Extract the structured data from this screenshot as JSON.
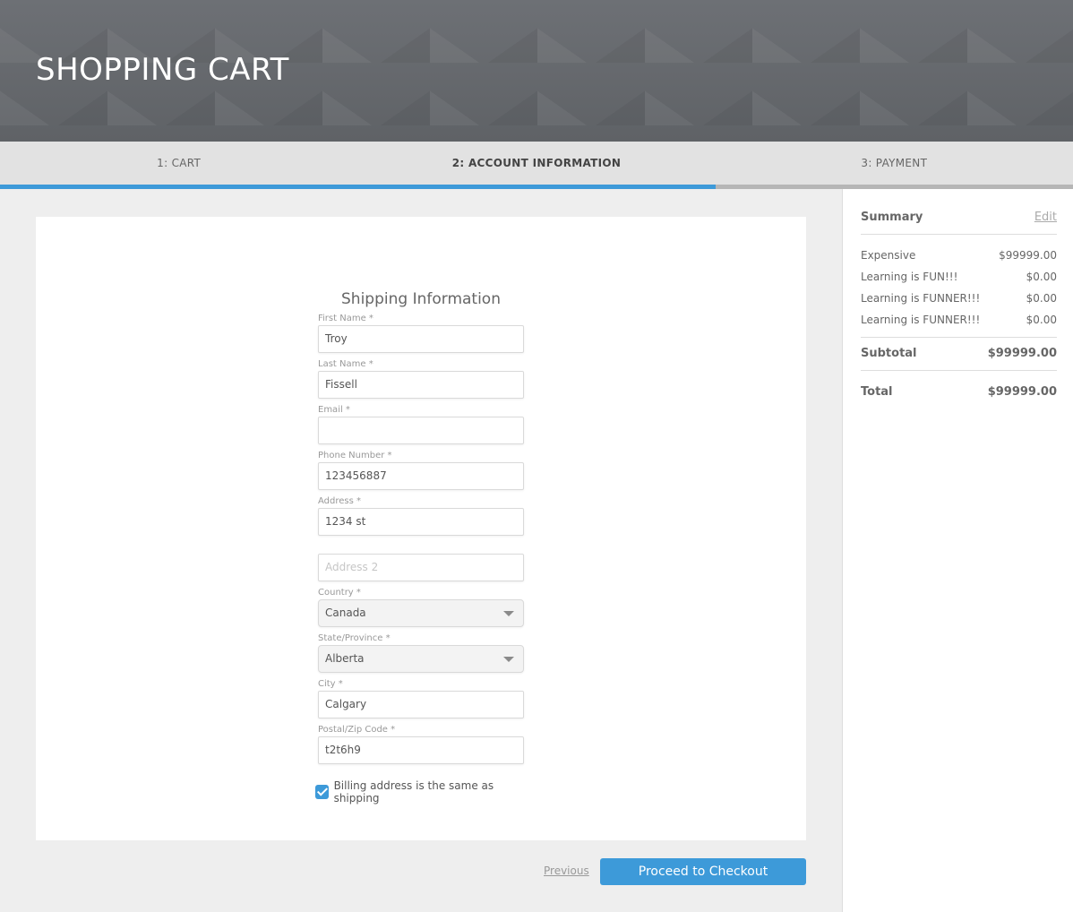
{
  "header": {
    "title": "SHOPPING CART"
  },
  "steps": [
    {
      "label": "1: CART"
    },
    {
      "label": "2: ACCOUNT INFORMATION"
    },
    {
      "label": "3: PAYMENT"
    }
  ],
  "progress": {
    "fraction": 0.667,
    "color": "#3d9ad9"
  },
  "form": {
    "title": "Shipping Information",
    "first_name": {
      "label": "First Name *",
      "value": "Troy"
    },
    "last_name": {
      "label": "Last Name *",
      "value": "Fissell"
    },
    "email": {
      "label": "Email *",
      "value": ""
    },
    "phone": {
      "label": "Phone Number *",
      "value": "123456887"
    },
    "address": {
      "label": "Address *",
      "value": "1234 st"
    },
    "address2": {
      "label": "",
      "placeholder": "Address 2"
    },
    "country": {
      "label": "Country *",
      "value": "Canada"
    },
    "state": {
      "label": "State/Province *",
      "value": "Alberta"
    },
    "city": {
      "label": "City *",
      "value": "Calgary"
    },
    "postal": {
      "label": "Postal/Zip Code *",
      "value": "t2t6h9"
    },
    "billing_same": {
      "label": "Billing address is the same as shipping",
      "checked": true
    }
  },
  "actions": {
    "previous_label": "Previous",
    "checkout_label": "Proceed to Checkout"
  },
  "summary": {
    "title": "Summary",
    "edit_label": "Edit",
    "items": [
      {
        "name": "Expensive",
        "price": "$99999.00"
      },
      {
        "name": "Learning is FUN!!!",
        "price": "$0.00"
      },
      {
        "name": "Learning is FUNNER!!!",
        "price": "$0.00"
      },
      {
        "name": "Learning is FUNNER!!!",
        "price": "$0.00"
      }
    ],
    "subtotal_label": "Subtotal",
    "subtotal_value": "$99999.00",
    "total_label": "Total",
    "total_value": "$99999.00"
  }
}
